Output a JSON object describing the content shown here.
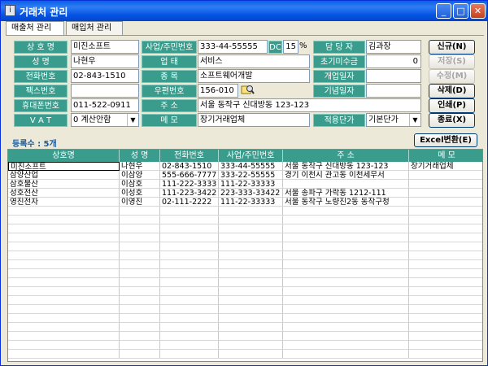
{
  "window": {
    "title": "거래처 관리",
    "icon": "app-icon",
    "minimize": "_",
    "maximize": "□",
    "close": "✕"
  },
  "tabs": [
    {
      "label": "매출처 관리"
    },
    {
      "label": "매입처 관리"
    }
  ],
  "form": {
    "company_label": "상 호 명",
    "company": "미진소프트",
    "reg_label": "사업/주민번호",
    "reg": "333-44-55555",
    "dc_label": "DC",
    "dc": "15",
    "dc_unit": "%",
    "manager_label": "담 당 자",
    "manager": "김과장",
    "name_label": "성 명",
    "name": "나현우",
    "biztype_label": "업 태",
    "biztype": "서비스",
    "initial_unpaid_label": "초기미수금",
    "initial_unpaid": "0",
    "phone_label": "전화번호",
    "phone": "02-843-1510",
    "item_label": "종 목",
    "item": "소프트웨어개발",
    "open_date_label": "개업일자",
    "open_date": "",
    "fax_label": "팩스번호",
    "fax": "",
    "zip_label": "우편번호",
    "zip": "156-010",
    "anniv_label": "기념일자",
    "anniv": "",
    "mobile_label": "휴대폰번호",
    "mobile": "011-522-0911",
    "address_label": "주 소",
    "address": "서울 동작구 신대방동 123-123",
    "vat_label": "V A T",
    "vat": "0 계산안함",
    "memo_label": "메 모",
    "memo": "장기거래업체",
    "price_label": "적용단가",
    "price": "기본단가"
  },
  "buttons": {
    "new": "신규(N)",
    "save": "저장(S)",
    "edit": "수정(M)",
    "delete": "삭제(D)",
    "print": "인쇄(P)",
    "exit": "종료(X)",
    "excel": "Excel변환(E)"
  },
  "count_text": "등록수 : 5개",
  "grid": {
    "headers": [
      "상호명",
      "성 명",
      "전화번호",
      "사업/주민번호",
      "주 소",
      "메 모"
    ],
    "rows": [
      [
        "미진소프트",
        "나현우",
        "02-843-1510",
        "333-44-55555",
        "서울 동작구 신대방동 123-123",
        "장기거래업체"
      ],
      [
        "삼양산업",
        "이삼양",
        "555-666-7777",
        "333-22-55555",
        "경기 이천시 관고동 이천세무서",
        ""
      ],
      [
        "삼호물산",
        "이삼호",
        "111-222-3333",
        "111-22-33333",
        "",
        ""
      ],
      [
        "성호전산",
        "이성호",
        "111-223-3422",
        "223-333-33422",
        "서울 송파구 가락동 1212-111",
        ""
      ],
      [
        "영진전자",
        "이영진",
        "02-111-2222",
        "111-22-33333",
        "서울 동작구 노량진2동 동작구청",
        ""
      ]
    ]
  }
}
